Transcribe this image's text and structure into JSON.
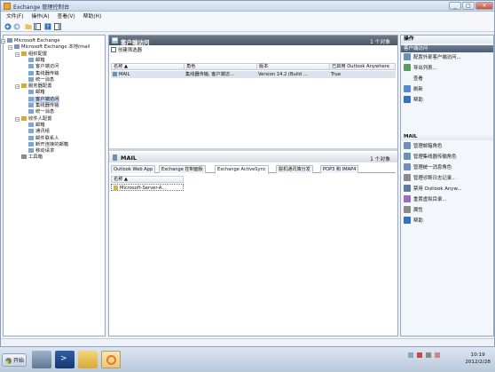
{
  "window": {
    "title": "Exchange 管理控制台",
    "min": "_",
    "max": "□",
    "close": "×"
  },
  "menu": [
    "文件(F)",
    "操作(A)",
    "查看(V)",
    "帮助(H)"
  ],
  "tree": [
    {
      "label": "Microsoft Exchange",
      "depth": 0,
      "exp": "−"
    },
    {
      "label": "Microsoft Exchange 本地(mail",
      "depth": 1,
      "exp": "−"
    },
    {
      "label": "组织配置",
      "depth": 2,
      "exp": "−"
    },
    {
      "label": "邮箱",
      "depth": 3
    },
    {
      "label": "客户端访问",
      "depth": 3
    },
    {
      "label": "集线器传输",
      "depth": 3
    },
    {
      "label": "统一消息",
      "depth": 3
    },
    {
      "label": "服务器配置",
      "depth": 2,
      "exp": "−"
    },
    {
      "label": "邮箱",
      "depth": 3
    },
    {
      "label": "客户端访问",
      "depth": 3,
      "selected": true
    },
    {
      "label": "集线器传输",
      "depth": 3
    },
    {
      "label": "统一消息",
      "depth": 3
    },
    {
      "label": "收件人配置",
      "depth": 2,
      "exp": "−"
    },
    {
      "label": "邮箱",
      "depth": 3
    },
    {
      "label": "通讯组",
      "depth": 3
    },
    {
      "label": "邮件联系人",
      "depth": 3
    },
    {
      "label": "断开连接的邮箱",
      "depth": 3
    },
    {
      "label": "移动请求",
      "depth": 3
    },
    {
      "label": "工具箱",
      "depth": 2
    }
  ],
  "top_pane": {
    "title": "客户端访问",
    "count": "1 个对象",
    "filter": "创建筛选器",
    "columns": [
      "名称 ▲",
      "角色",
      "版本",
      "已启用 Outlook Anywhere"
    ],
    "rows": [
      [
        "MAIL",
        "集线器传输, 客户端访...",
        "Version 14.2 (Build ...",
        "True"
      ]
    ]
  },
  "bottom_pane": {
    "title": "MAIL",
    "count": "1 个对象",
    "tabs": [
      "Outlook Web App",
      "Exchange 控制面板",
      "Exchange ActiveSync",
      "脱机通讯簿分发",
      "POP3 和 IMAP4"
    ],
    "active_tab": 2,
    "columns": [
      "名称 ▲"
    ],
    "rows": [
      "Microsoft-Server-A..."
    ]
  },
  "actions": {
    "header": "操作",
    "section1": "客户端访问",
    "items1": [
      "配置外部客户端访问...",
      "导出列表...",
      "查看",
      "刷新",
      "帮助"
    ],
    "section2": "MAIL",
    "items2": [
      "管理邮箱角色",
      "管理集线器传输角色",
      "管理统一消息角色",
      "管理诊断日志记录...",
      "禁用 Outlook Anyw...",
      "重置虚拟目录...",
      "属性",
      "帮助"
    ]
  },
  "taskbar": {
    "start": "开始",
    "time": "10:19",
    "date": "2012/2/28"
  }
}
